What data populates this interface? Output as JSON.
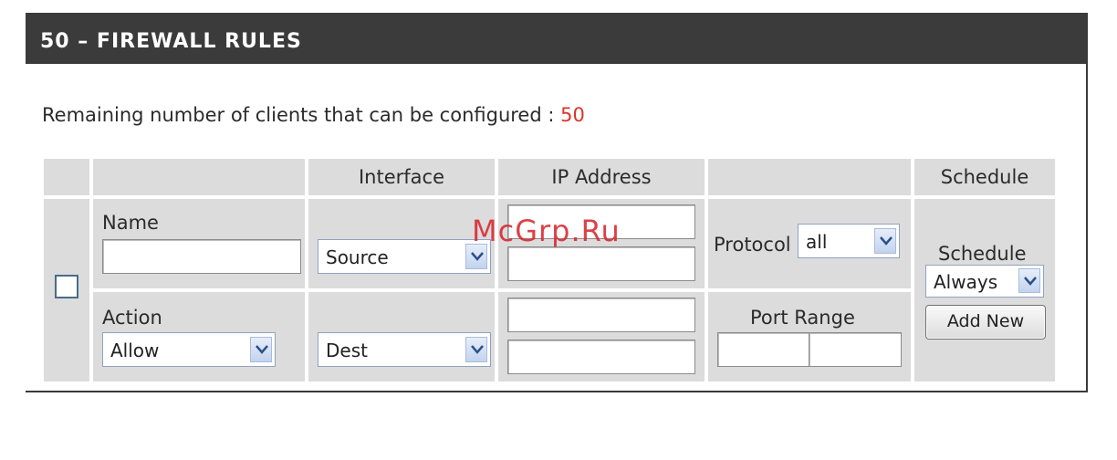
{
  "header": {
    "title": "50 – FIREWALL RULES"
  },
  "remaining": {
    "label": "Remaining number of clients that can be configured : ",
    "count": "50"
  },
  "columns": {
    "interface": "Interface",
    "ip_address": "IP Address",
    "schedule": "Schedule"
  },
  "rule": {
    "checked": false,
    "name_label": "Name",
    "name_value": "",
    "action_label": "Action",
    "action_selected": "Allow",
    "source_interface": "Source",
    "dest_interface": "Dest",
    "source_ip_start": "",
    "source_ip_end": "",
    "dest_ip_start": "",
    "dest_ip_end": "",
    "protocol_label": "Protocol",
    "protocol_selected": "all",
    "port_range_label": "Port Range",
    "port_start": "",
    "port_end": "",
    "schedule_label": "Schedule",
    "schedule_selected": "Always",
    "add_new_label": "Add New"
  },
  "watermark": "McGrp.Ru",
  "colors": {
    "header_bg": "#3b3b3b",
    "count": "#e0322a",
    "cell_bg": "#dcdcdc"
  }
}
